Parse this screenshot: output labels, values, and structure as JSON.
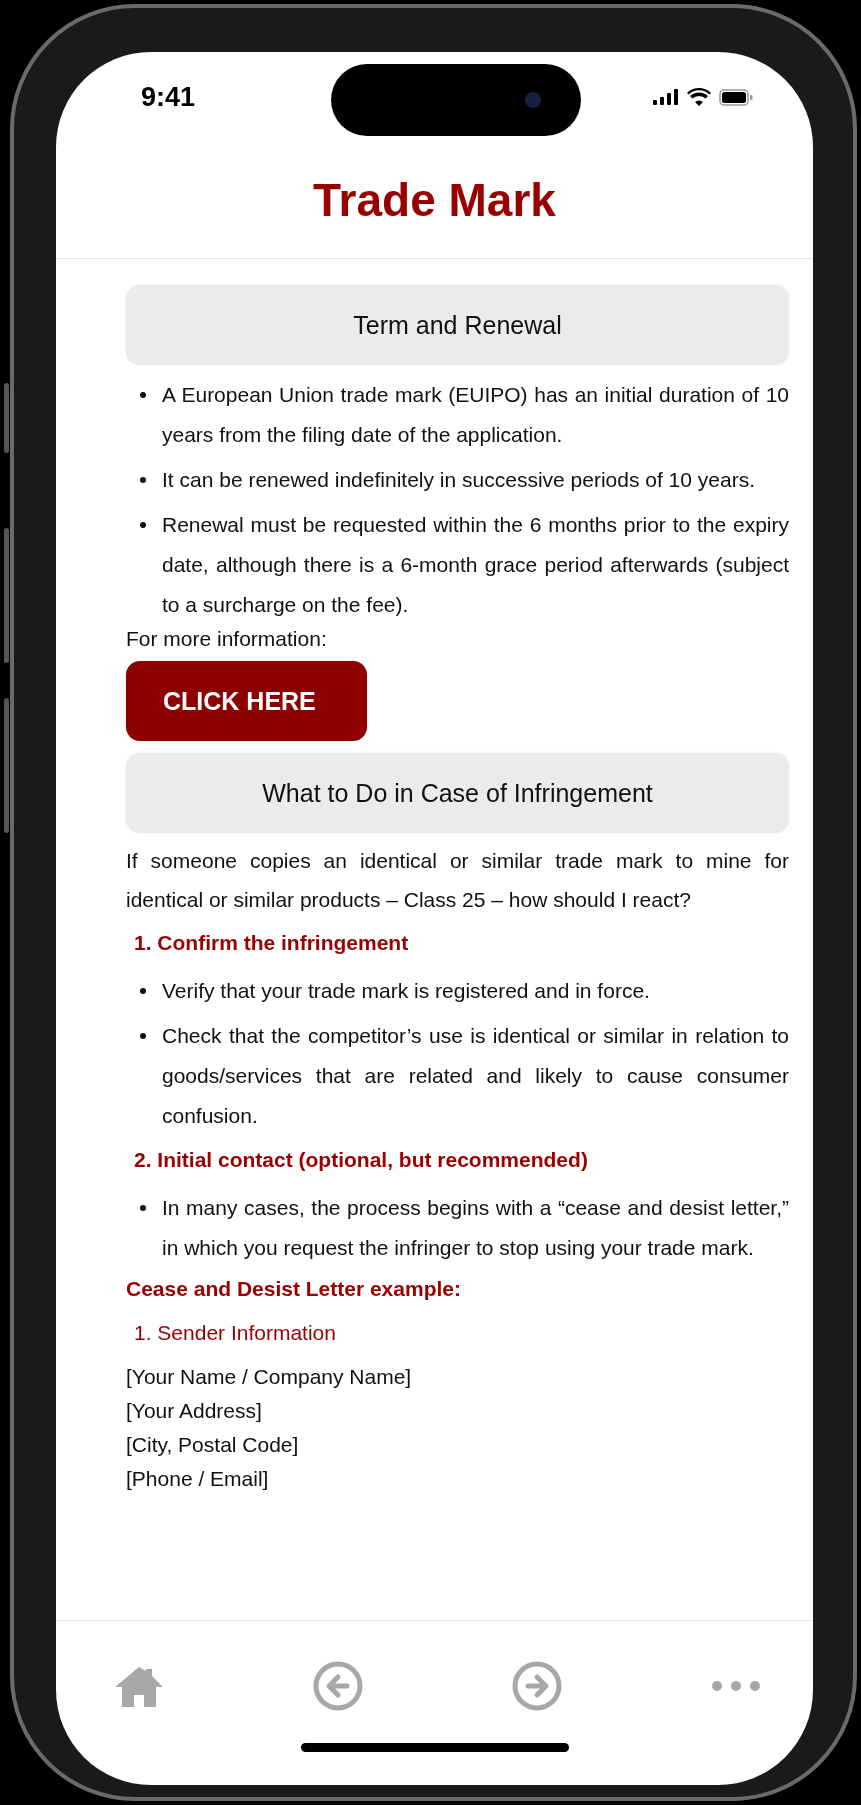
{
  "status_bar": {
    "time": "9:41"
  },
  "header": {
    "title": "Trade Mark"
  },
  "term_section": {
    "title": "Term and Renewal",
    "bullets": [
      "A European Union trade mark (EUIPO) has an initial duration of 10 years from the filing date of the application.",
      "It can be renewed indefinitely in successive periods of 10 years.",
      "Renewal must be requested within the 6 months prior to the expiry date, although there is a 6-month grace period afterwards (subject to a surcharge on the fee)."
    ],
    "more_info": "For more information:",
    "button": "CLICK HERE"
  },
  "infringement_section": {
    "title": "What to Do in Case of Infringement",
    "intro": "If someone copies an identical or similar trade mark to mine for identical or similar products – Class 25 – how should I react?",
    "steps": [
      {
        "title": "1. Confirm the infringement",
        "bullets": [
          "Verify that your trade mark is registered and in force.",
          "Check that the competitor’s use is identical or similar in relation to goods/services that are related and likely to cause consumer confusion."
        ]
      },
      {
        "title": "2. Initial contact (optional, but recommended)",
        "bullets": [
          "In many cases, the process begins with a “cease and desist letter,” in which you request the infringer to stop using your trade mark."
        ]
      }
    ],
    "example": {
      "title": "Cease and Desist Letter example:",
      "subheading": "1. Sender Information",
      "lines": [
        "[Your Name / Company Name]",
        "[Your Address]",
        "[City, Postal Code]",
        "[Phone / Email]"
      ]
    }
  }
}
